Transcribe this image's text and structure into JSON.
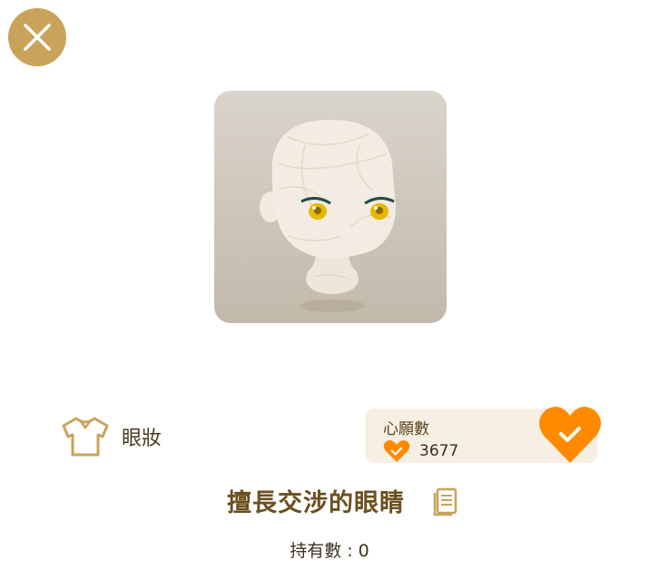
{
  "close": {
    "icon": "close-icon"
  },
  "preview": {
    "icon": "mannequin-head-eyes-preview"
  },
  "category": {
    "icon": "shirt-icon",
    "label": "眼妝"
  },
  "wish": {
    "title": "心願數",
    "count": "3677",
    "count_icon": "heart-check-icon",
    "button_icon": "heart-check-icon",
    "accent": "#ff8a00"
  },
  "item": {
    "name": "擅長交涉的眼睛",
    "copy_icon": "copy-icon"
  },
  "owned": {
    "label": "持有數 : 0"
  },
  "colors": {
    "gold": "#c9a35a",
    "card_bg": "#f7efe3",
    "title": "#6b4f1d"
  }
}
